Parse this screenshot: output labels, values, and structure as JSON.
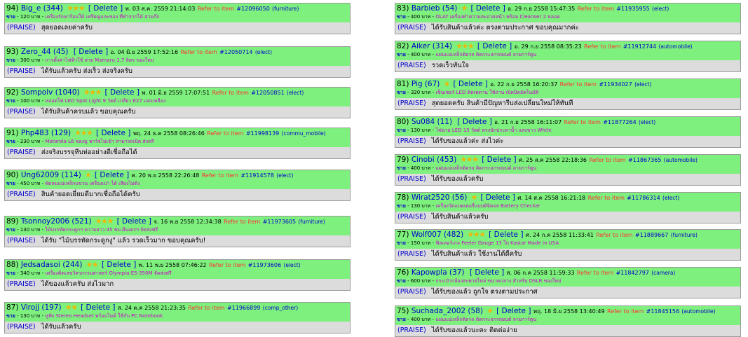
{
  "labels": {
    "delete": "[ Delete ]",
    "refer": "Refer to item",
    "sale": "ขาย",
    "praise": "(PRAISE)"
  },
  "colors": {
    "header_bg": "#7ef07e",
    "body_bg": "#dcdcdc",
    "star": "#f4b400"
  },
  "left": [
    {
      "num": "94)",
      "user": "Big_e (344)",
      "stars": "★★★",
      "date": "พ. 03 ส.ค. 2559 21:14:03",
      "item_no": "#12096050",
      "category": "(furniture)",
      "price": "- 120 บาท -",
      "item": "เครื่องรักษาร้อนให้ เหรียญและของ ที่ทำจากไม้ สามก๊ก",
      "comment": "สุดยอดเลยค่าครับ"
    },
    {
      "num": "93)",
      "user": "Zero_44 (45)",
      "stars": "",
      "date": "อ. 04 มิ.ย 2559 17:52:16",
      "item_no": "#12050714",
      "category": "(elect)",
      "price": "- 300 บาท -",
      "item": "การตั้งค่าไฟฟ้าใช้ สาย Mamaru 1.7 ลิตร ของใหม่",
      "comment": "ได้รับแล้วครับ ส่งเร็ว ส่งจริงครับ"
    },
    {
      "num": "92)",
      "user": "Sompolv (1040)",
      "stars": "★★★",
      "date": "พ. 01 มิ.ย 2559 17:07:51",
      "item_no": "#12050851",
      "category": "(elect)",
      "price": "- 100 บาท -",
      "item": "หลอดไฟ LED Spot Light 9 วัตต์ เกลียว E27 แสงเหลือง",
      "comment": "ได้รับสินค้าครบแล้ว ขอบคุณครับ"
    },
    {
      "num": "91)",
      "user": "Php483 (129)",
      "stars": "★★★",
      "date": "พฤ. 24 ธ.ค 2558 08:26:46",
      "item_no": "#11998139",
      "category": "(commu_mobile)",
      "price": "- 230 บาท -",
      "item": "Motorola L6 ของมู ชาร์จไม่เข้า สามารถเปิด ส่งฟรี",
      "comment": "ส่งจริงบรรจุหีบห่ออย่างดีเชื่อถือได้"
    },
    {
      "num": "90)",
      "user": "Ung62009 (114)",
      "stars": "★",
      "date": "ศ. 20 พ.ย 2558 22:26:48",
      "item_no": "#11914578",
      "category": "(elect)",
      "price": "- 450 บาท -",
      "item": "พัดลมแม่เหล็กแขวน เครื่องเป่า ได้ เสียงไม่ดัง",
      "comment": "สินค้ายอดเยี่ยมดีมากเชื่อถือได้ครับ"
    },
    {
      "num": "89)",
      "user": "Tsonnoy2006 (521)",
      "stars": "★★★",
      "date": "จ. 16 พ.ย 2558 12:34:38",
      "item_no": "#11973605",
      "category": "(furniture)",
      "price": "- 130 บาท -",
      "item": "ไม้บรรทัดกระดูกฯ ความยาว 45 ซม.ผืนเตรฯ จัดส่งฟรี",
      "comment": "ได้รับ \"ไม้บรรทัดกระดูกงู\" แล้ว รวดเร็วมาก ขอบคุณครับ!"
    },
    {
      "num": "88)",
      "user": "Jedsadasoi (244)",
      "stars": "★★",
      "date": "พ. 11 พ.ย 2558 07:46:22",
      "item_no": "#11973606",
      "category": "(elect)",
      "price": "- 340 บาท -",
      "item": "เครื่องคิดเลขวิศวกรรมศาสตร์ Olympia ES-350M จัดส่งฟรี",
      "comment": "ได้ของแล้วครับ ส่งไวมาก"
    },
    {
      "num": "87)",
      "user": "Virojj (197)",
      "stars": "★★",
      "date": "ส. 24 ต.ค 2558 21:23:35",
      "item_no": "#11966899",
      "category": "(comp_other)",
      "price": "- 130 บาท -",
      "item": "หูฟัง Stereo Headset พร้อมไมค์ ใช้กับ PC Notebook",
      "comment": "ได้รับแล้วครับ"
    }
  ],
  "right": [
    {
      "num": "83)",
      "user": "Barbieb (54)",
      "stars": "★",
      "date": "อ. 29 ก.ย 2558 15:47:35",
      "item_no": "#11935955",
      "category": "(elect)",
      "price": "- 400 บาท -",
      "item": "OLAY เครื่องทำความสะอาดหน้า พร้อม Cleanser 2 หลอด",
      "comment": "ได้รับสินค้าแล้วค่ะ ตรงตามประกาศ ขอบคุณมากค่ะ"
    },
    {
      "num": "82)",
      "user": "Aiker (314)",
      "stars": "★★★",
      "date": "อ. 29 ก.ย 2558 08:35:23",
      "item_no": "#11912744",
      "category": "(automobile)",
      "price": "- 400 บาท -",
      "item": "แผ่นแม่เหล็กติดรถ ติดกระจกรถยนต์ ลายการ์ตูน",
      "comment": "รวดเร็วทันใจ"
    },
    {
      "num": "81)",
      "user": "Pig (67)",
      "stars": "★",
      "date": "อ. 22 ก.ย 2558 16:20:37",
      "item_no": "#11934027",
      "category": "(elect)",
      "price": "- 320 บาท -",
      "item": "เซ็นเซอร์ LED ติดเพดาน ใช้ถ่าน เปิดปิดอัตโนมัติ",
      "comment": "สุดยอดครับ สินค้ามีปัญหารีบส่งเปลี่ยนใหม่ให้ทันที"
    },
    {
      "num": "80)",
      "user": "Su084 (11)",
      "stars": "",
      "date": "อ. 21 ก.ย 2558 16:11:07",
      "item_no": "#11877264",
      "category": "(elect)",
      "price": "- 130 บาท -",
      "item": "ไฟฉาย LED 15 วัตต์ ทรงนักประดาน้ำ แสงขาว White",
      "comment": "ได้รับของแล้วค่ะ ส่งไวค่ะ"
    },
    {
      "num": "79)",
      "user": "Cinobi (453)",
      "stars": "★★★",
      "date": "ศ. 25 ส.ค 2558 22:18:36",
      "item_no": "#11867365",
      "category": "(automobile)",
      "price": "- 400 บาท -",
      "item": "แผ่นแม่เหล็กติดรถ ติดกระจกรถยนต์ ลายการ์ตูน",
      "comment": "ได้รับของแล้วครับ"
    },
    {
      "num": "78)",
      "user": "Wirat2520 (56)",
      "stars": "★",
      "date": "ศ. 14 ส.ค 2558 16:21:18",
      "item_no": "#11786314",
      "category": "(elect)",
      "price": "- 130 บาท -",
      "item": "เครื่องวัดแบตเตอรี่แบบดิจิตอล Battery Checker",
      "comment": "ได้รับสินค้าแล้วครับ"
    },
    {
      "num": "77)",
      "user": "Wolf007 (482)",
      "stars": "★★★",
      "date": "ศ. 24 ก.ค 2558 11:33:41",
      "item_no": "#11889667",
      "category": "(furniture)",
      "price": "- 150 บาท -",
      "item": "ฟิลเลอร์เกจ Feeler Gauge 13 ใบ Kastar Made in USA",
      "comment": "ได้รับสินค้าแล้ว ใช้งานได้ดีครับ"
    },
    {
      "num": "76)",
      "user": "Kapowpla (37)",
      "stars": "",
      "date": "ส. 06 ก.ค 2558 11:59:33",
      "item_no": "#11842797",
      "category": "(camera)",
      "price": "- 600 บาท -",
      "item": "กระเป๋ากล้องสะพายไหล่ ขนาดกลาง สำหรับ DSLR ของใหม่",
      "comment": "ได้รับของแล้ว ถูกใจ ตรงตามประกาศ"
    },
    {
      "num": "75)",
      "user": "Suchada_2002 (58)",
      "stars": "★",
      "date": "พฤ. 18 มิ.ย 2558 13:40:49",
      "item_no": "#11845156",
      "category": "(automobile)",
      "price": "- 400 บาท -",
      "item": "แผ่นแม่เหล็กติดรถ ติดกระจกรถยนต์ ลายการ์ตูน",
      "comment": "ได้รับของแล้วนะคะ ติดต่อง่าย"
    }
  ]
}
